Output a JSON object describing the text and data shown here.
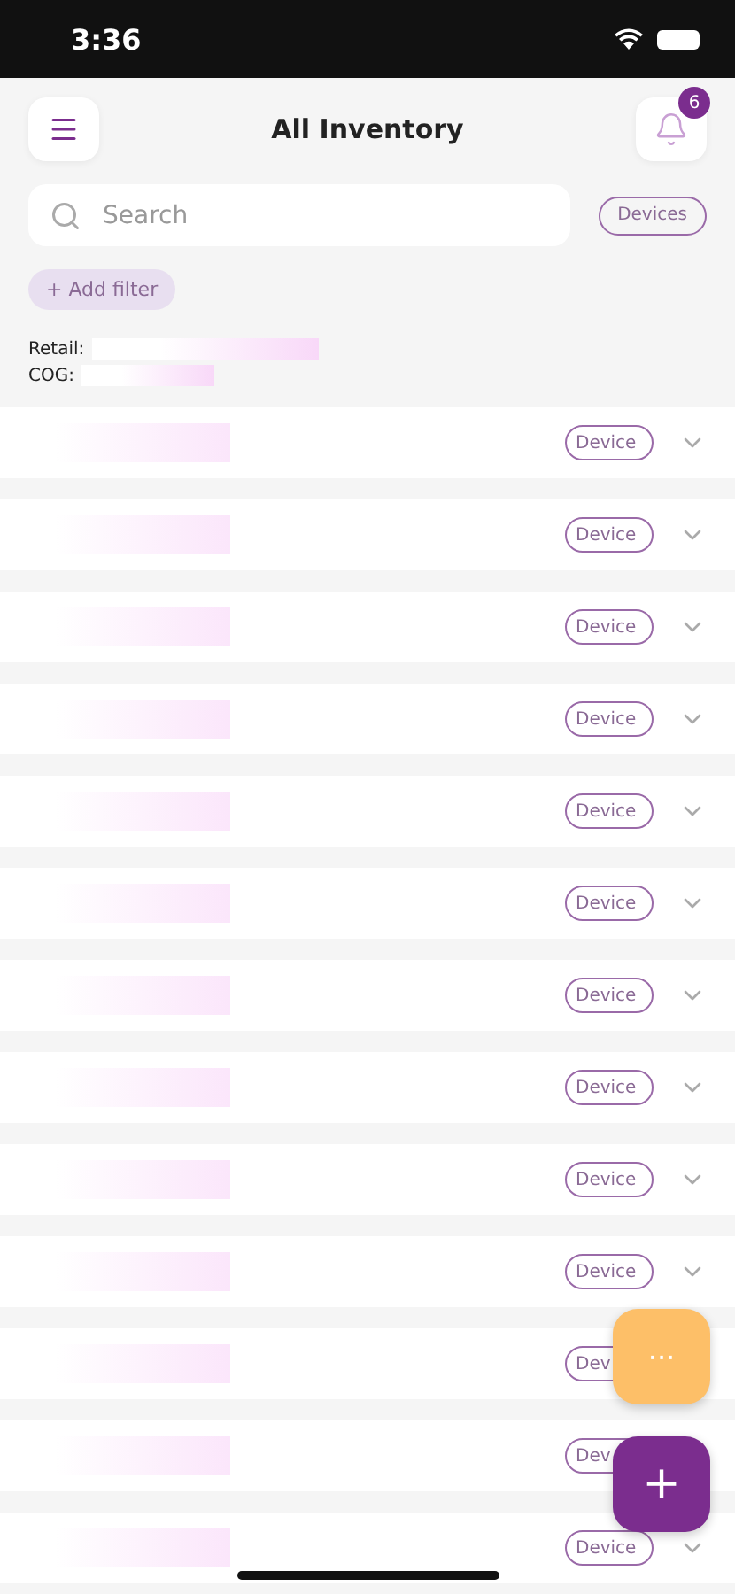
{
  "status_bar": {
    "time": "3:36"
  },
  "header": {
    "title": "All Inventory",
    "notification_count": "6"
  },
  "search": {
    "placeholder": "Search"
  },
  "type_filter": {
    "label": "Devices"
  },
  "add_filter": {
    "label": "+ Add filter"
  },
  "totals": [
    {
      "label": "Retail:"
    },
    {
      "label": "COG:"
    }
  ],
  "items": [
    {
      "tag": "Device"
    },
    {
      "tag": "Device"
    },
    {
      "tag": "Device"
    },
    {
      "tag": "Device"
    },
    {
      "tag": "Device"
    },
    {
      "tag": "Device"
    },
    {
      "tag": "Device"
    },
    {
      "tag": "Device"
    },
    {
      "tag": "Device"
    },
    {
      "tag": "Device"
    },
    {
      "tag": "Dev",
      "chevron": false
    },
    {
      "tag": "Dev",
      "chevron": false
    },
    {
      "tag": "Device"
    }
  ],
  "fabs": [
    {
      "kind": "more",
      "label": "···"
    },
    {
      "kind": "add",
      "label": "+"
    }
  ]
}
